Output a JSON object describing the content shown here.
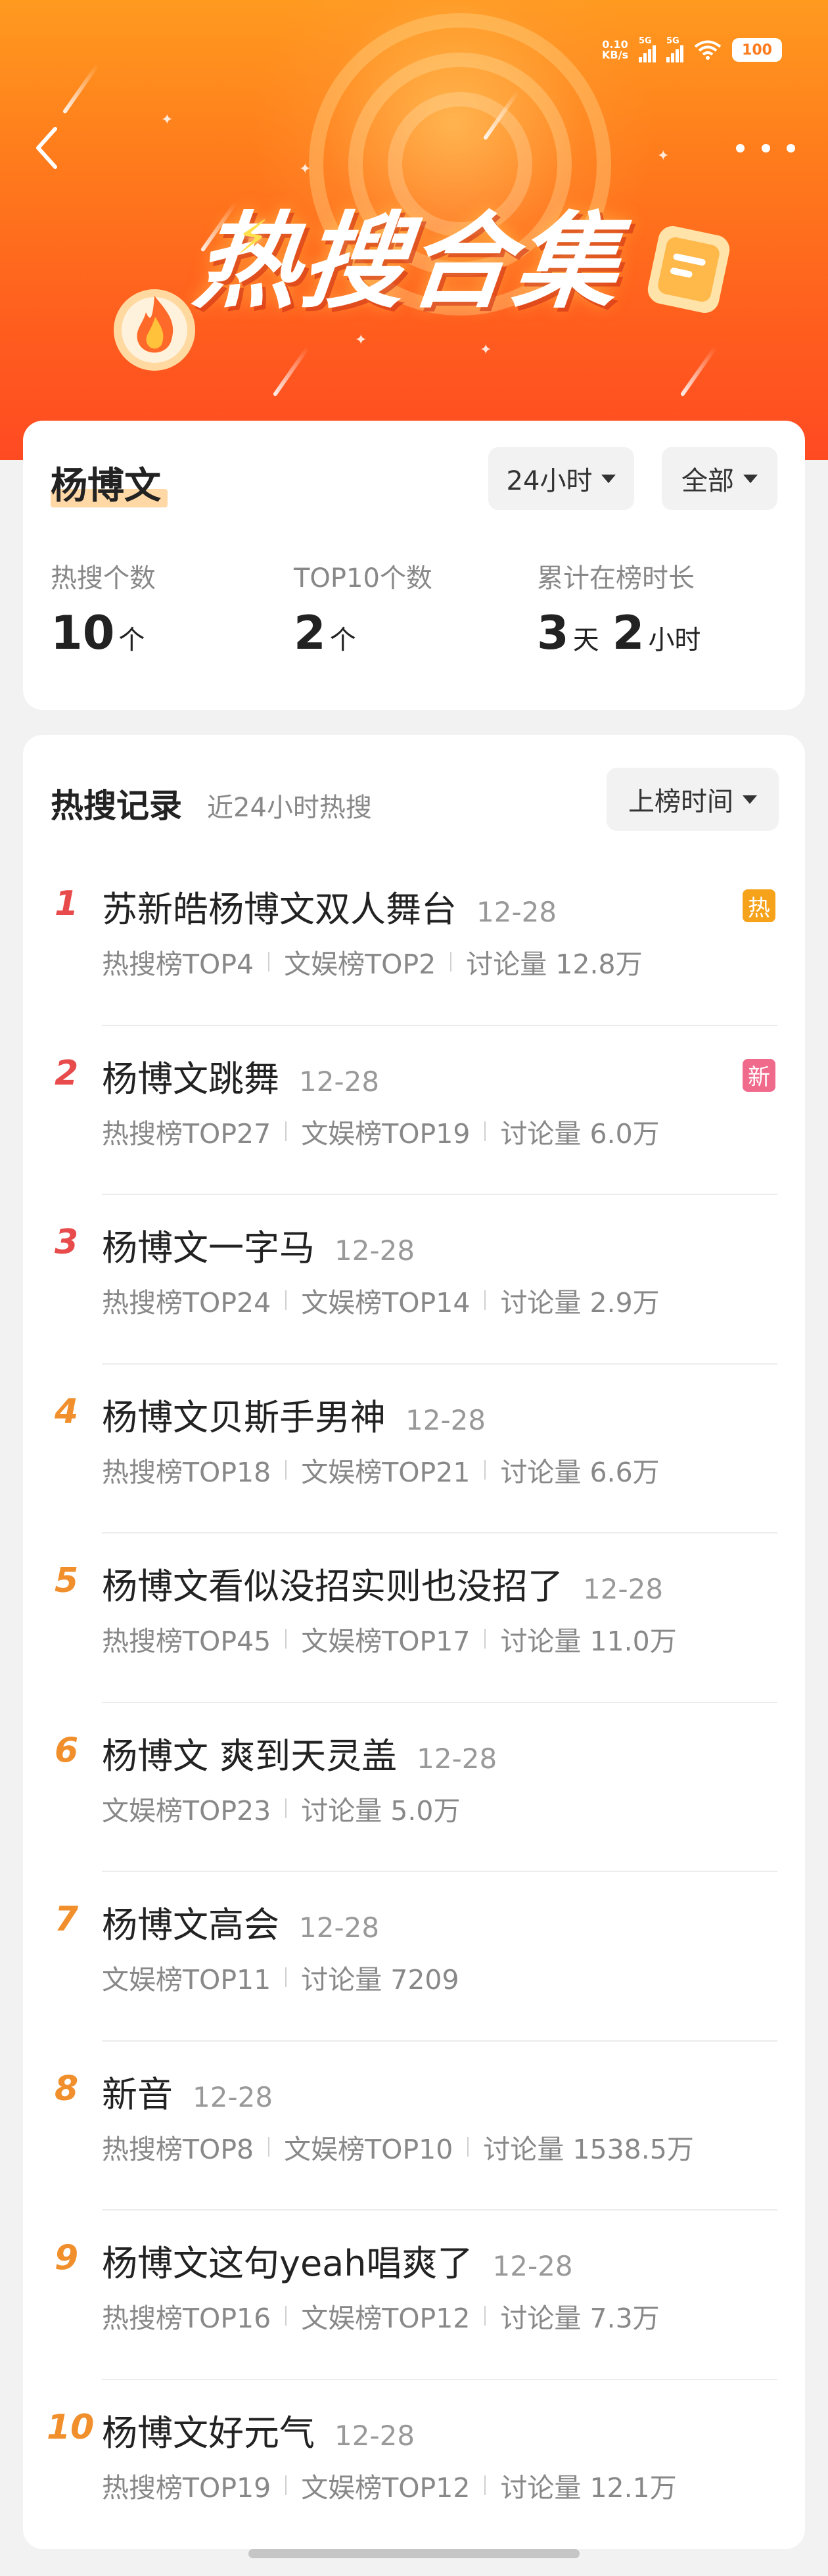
{
  "status_bar": {
    "net_speed_value": "0.10",
    "net_speed_unit": "KB/s",
    "sim1": "5G",
    "sim2": "5G",
    "battery": "100"
  },
  "hero": {
    "title": "热搜合集"
  },
  "summary": {
    "name": "杨博文",
    "range_filter": "24小时",
    "scope_filter": "全部",
    "stats": [
      {
        "label": "热搜个数",
        "value": "10",
        "unit": "个"
      },
      {
        "label": "TOP10个数",
        "value": "2",
        "unit": "个"
      },
      {
        "label": "累计在榜时长",
        "value_days": "3",
        "unit_days": "天",
        "value_hours": "2",
        "unit_hours": "小时"
      }
    ]
  },
  "records": {
    "title": "热搜记录",
    "subtitle": "近24小时热搜",
    "sort_label": "上榜时间",
    "items": [
      {
        "rank": "1",
        "title": "苏新皓杨博文双人舞台",
        "date": "12-28",
        "badge": "热",
        "meta": [
          "热搜榜TOP4",
          "文娱榜TOP2",
          "讨论量 12.8万"
        ]
      },
      {
        "rank": "2",
        "title": "杨博文跳舞",
        "date": "12-28",
        "badge": "新",
        "meta": [
          "热搜榜TOP27",
          "文娱榜TOP19",
          "讨论量 6.0万"
        ]
      },
      {
        "rank": "3",
        "title": "杨博文一字马",
        "date": "12-28",
        "meta": [
          "热搜榜TOP24",
          "文娱榜TOP14",
          "讨论量 2.9万"
        ]
      },
      {
        "rank": "4",
        "title": "杨博文贝斯手男神",
        "date": "12-28",
        "meta": [
          "热搜榜TOP18",
          "文娱榜TOP21",
          "讨论量 6.6万"
        ]
      },
      {
        "rank": "5",
        "title": "杨博文看似没招实则也没招了",
        "date": "12-28",
        "meta": [
          "热搜榜TOP45",
          "文娱榜TOP17",
          "讨论量 11.0万"
        ]
      },
      {
        "rank": "6",
        "title": "杨博文 爽到天灵盖",
        "date": "12-28",
        "meta": [
          "文娱榜TOP23",
          "讨论量 5.0万"
        ]
      },
      {
        "rank": "7",
        "title": "杨博文高会",
        "date": "12-28",
        "meta": [
          "文娱榜TOP11",
          "讨论量 7209"
        ]
      },
      {
        "rank": "8",
        "title": "新音",
        "date": "12-28",
        "meta": [
          "热搜榜TOP8",
          "文娱榜TOP10",
          "讨论量 1538.5万"
        ]
      },
      {
        "rank": "9",
        "title": "杨博文这句yeah唱爽了",
        "date": "12-28",
        "meta": [
          "热搜榜TOP16",
          "文娱榜TOP12",
          "讨论量 7.3万"
        ]
      },
      {
        "rank": "10",
        "title": "杨博文好元气",
        "date": "12-28",
        "meta": [
          "热搜榜TOP19",
          "文娱榜TOP12",
          "讨论量 12.1万"
        ]
      }
    ]
  },
  "colors": {
    "top_rank": "#e84b4b",
    "rank": "#f08f2b",
    "hot_badge": "#f6a21a",
    "new_badge": "#f06a8c",
    "name_highlight": "#ffd8a6"
  },
  "icons": {
    "back": "chevron-left-icon",
    "more": "more-dots-icon",
    "filter_caret": "caret-down-icon"
  }
}
